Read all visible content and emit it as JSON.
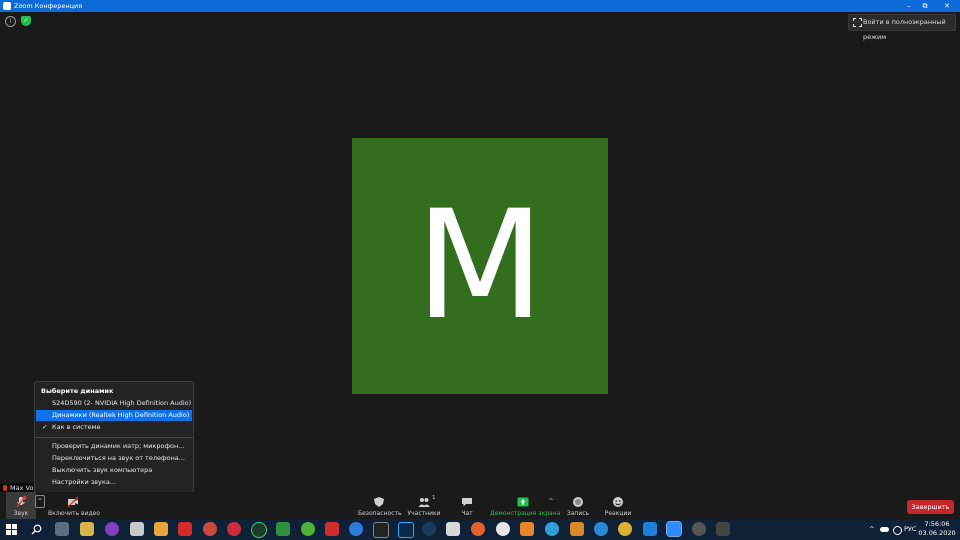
{
  "window": {
    "title": "Zoom Конференция",
    "minimize": "–",
    "maximize": "⧉",
    "close": "✕"
  },
  "top": {
    "info_glyph": "i",
    "shield_glyph": "✓",
    "fullscreen_label": "Войти в полноэкранный режим"
  },
  "avatar": {
    "letter": "M",
    "color": "#336e1e"
  },
  "participant": {
    "name": "Max Vo"
  },
  "speaker_menu": {
    "heading": "Выберите динамик",
    "devices": [
      "S24D590 (2- NVIDIA High Definition Audio)",
      "Динамики (Realtek High Definition Audio)",
      "Как в системе"
    ],
    "selected_index": 1,
    "checked_index": 2,
    "check_glyph": "✓",
    "actions": [
      "Проверить динамик иатр; микрофон...",
      "Переключиться на звук от телефона...",
      "Выключить звук компьютера",
      "Настройки звука..."
    ]
  },
  "toolbar": {
    "audio": "Звук",
    "video": "Включить видео",
    "security": "Безопасность",
    "participants": "Участники",
    "participants_count": "1",
    "chat": "Чат",
    "share": "Демонстрация экрана",
    "record": "Запись",
    "reactions": "Реакции",
    "caret": "^",
    "end": "Завершить"
  },
  "taskbar": {
    "language": "РУС",
    "time": "7:56:06",
    "date": "03.06.2020",
    "tray_chevron": "^"
  }
}
